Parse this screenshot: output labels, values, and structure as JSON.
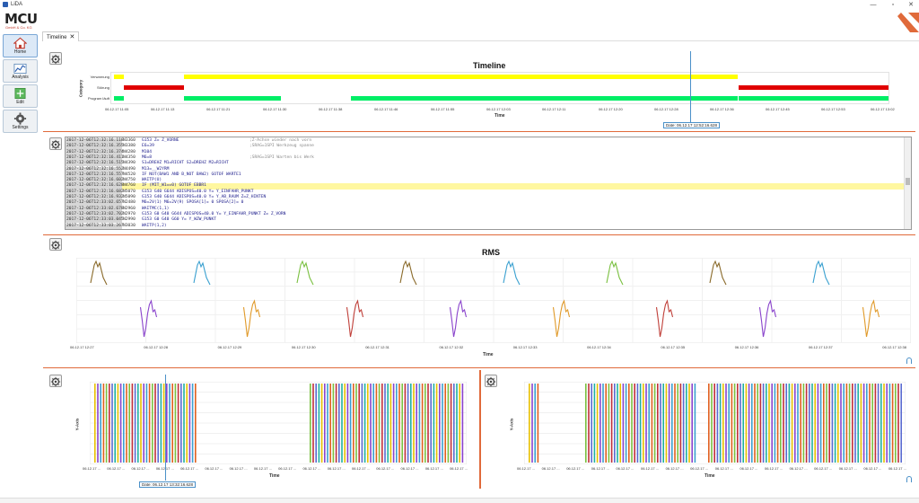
{
  "app": {
    "title": "LiDA"
  },
  "window_controls": [
    "—",
    "▫",
    "✕"
  ],
  "logo": {
    "brand": "MCU",
    "sub": "GmbH & Co. KG"
  },
  "sidebar": {
    "items": [
      {
        "label": "Home",
        "icon": "home-icon"
      },
      {
        "label": "Analysis",
        "icon": "analysis-icon"
      },
      {
        "label": "Edit",
        "icon": "edit-icon"
      },
      {
        "label": "Settings",
        "icon": "settings-icon"
      }
    ]
  },
  "tabs": [
    {
      "label": "Timeline",
      "close": "✕"
    }
  ],
  "timeline": {
    "title": "Timeline",
    "y_axis_label": "Category",
    "x_axis_label": "Time",
    "categories": [
      "Verwarnung",
      "Störung",
      "Program läuft"
    ],
    "ticks": [
      "06.12.17 11:05",
      "06.12.17 11:13",
      "06.12.17 11:21",
      "06.12.17 11:30",
      "06.12.17 11:38",
      "06.12.17 11:46",
      "06.12.17 11:55",
      "06.12.17 12:03",
      "06.12.17 12:11",
      "06.12.17 12:20",
      "06.12.17 12:28",
      "06.12.17 12:36",
      "06.12.17 12:45",
      "06.12.17 12:53",
      "06.12.17 13:02"
    ],
    "cursor_label": "Date: 06.12.17 12:52:16.628",
    "colors": {
      "warning": "#ffff00",
      "error": "#e00000",
      "running": "#00ee66"
    }
  },
  "code": {
    "lines": [
      {
        "ts": "2017-12-06T12:32:16.118",
        "ln": "N3360",
        "tx": "G153 Z= Z_VORNE",
        "cm": ";Z-Achse wieder nach vorn"
      },
      {
        "ts": "2017-12-06T12:32:16.355",
        "ln": "N3380",
        "tx": "E6=39",
        "cm": ";SRAG=1SPI Werkzeug spanne"
      },
      {
        "ts": "2017-12-06T12:32:16.374",
        "ln": "N4280",
        "tx": "M104",
        "cm": ""
      },
      {
        "ts": "2017-12-06T12:32:16.411",
        "ln": "N4350",
        "tx": "M6=8",
        "cm": ";SRAG=1SPI Warten bis Werk"
      },
      {
        "ts": "2017-12-06T12:32:16.515",
        "ln": "N4390",
        "tx": "S1=DREHZ M1=RICHT S2=DREHZ M2=RICHT",
        "cm": ""
      },
      {
        "ts": "2017-12-06T12:32:16.552",
        "ln": "N4490",
        "tx": "   M13=__W2YRM",
        "cm": ""
      },
      {
        "ts": "2017-12-06T12:32:16.557",
        "ln": "N4520",
        "tx": "IF NOT(BAW1 AND B_NOT BAW2) GOTOF WARTE1",
        "cm": ""
      },
      {
        "ts": "2017-12-06T12:32:16.602",
        "ln": "N4750",
        "tx": "WAITP(U)",
        "cm": ""
      },
      {
        "ts": "2017-12-06T12:32:16.628",
        "ln": "N4760",
        "tx": "IF (MIT_W1==0) GOTOF EBBR1",
        "cm": ""
      },
      {
        "ts": "2017-12-06T12:32:16.682",
        "ln": "N5070",
        "tx": "G153 G40 G644 ADISPOS=40.0 Y= Y_EINFAHR_PUNKT",
        "cm": ""
      },
      {
        "ts": "2017-12-06T12:32:16.932",
        "ln": "N5090",
        "tx": "G153 G40 G644 ADISPOS=40.0 Y= Y_AB_RAUM Z=Z_HINTEN",
        "cm": ""
      },
      {
        "ts": "2017-12-06T12:33:02.657",
        "ln": "N2480",
        "tx": "M6=2V(1) M6=2V(9) SPOSA[1]= 0 SPOSA[2]= 0",
        "cm": ""
      },
      {
        "ts": "2017-12-06T12:33:02.678",
        "ln": "N2960",
        "tx": "WAITMC(1,1)",
        "cm": ""
      },
      {
        "ts": "2017-12-06T12:33:02.702",
        "ln": "N2970",
        "tx": "G153 G0 G40 G644 ADISPOS=40.0  Y= Y_EINFAHR_PUNKT Z= Z_VORN",
        "cm": ""
      },
      {
        "ts": "2017-12-06T12:33:03.045",
        "ln": "N2990",
        "tx": "G153 G0 G40 G60 Y= Y_WZW_PUNKT",
        "cm": ""
      },
      {
        "ts": "2017-12-06T12:33:03.267",
        "ln": "N3030",
        "tx": "WAITP(1,2)",
        "cm": ""
      }
    ],
    "highlight_index": 8
  },
  "rms": {
    "title": "RMS",
    "x_axis_label": "Time",
    "ticks": [
      "06.12.17 12:27",
      "06.12.17 12:28",
      "06.12.17 12:29",
      "06.12.17 12:30",
      "06.12.17 12:31",
      "06.12.17 12:32",
      "06.12.17 12:33",
      "06.12.17 12:34",
      "06.12.17 12:35",
      "06.12.17 12:36",
      "06.12.17 12:37",
      "06.12.17 12:38"
    ],
    "colors": [
      "#8a6a2a",
      "#8a44cc",
      "#3aa0d0",
      "#e09a2a",
      "#7ac040",
      "#c0403a"
    ]
  },
  "bottom_left": {
    "y_axis_label": "Y-Axis",
    "x_axis_label": "Time",
    "tick_label": "06.12.17 ...",
    "cursor_label": "Date: 06.12.17 13:32:16.628"
  },
  "bottom_right": {
    "y_axis_label": "Y-Axis",
    "x_axis_label": "Time",
    "tick_label": "06.12.17 ..."
  }
}
